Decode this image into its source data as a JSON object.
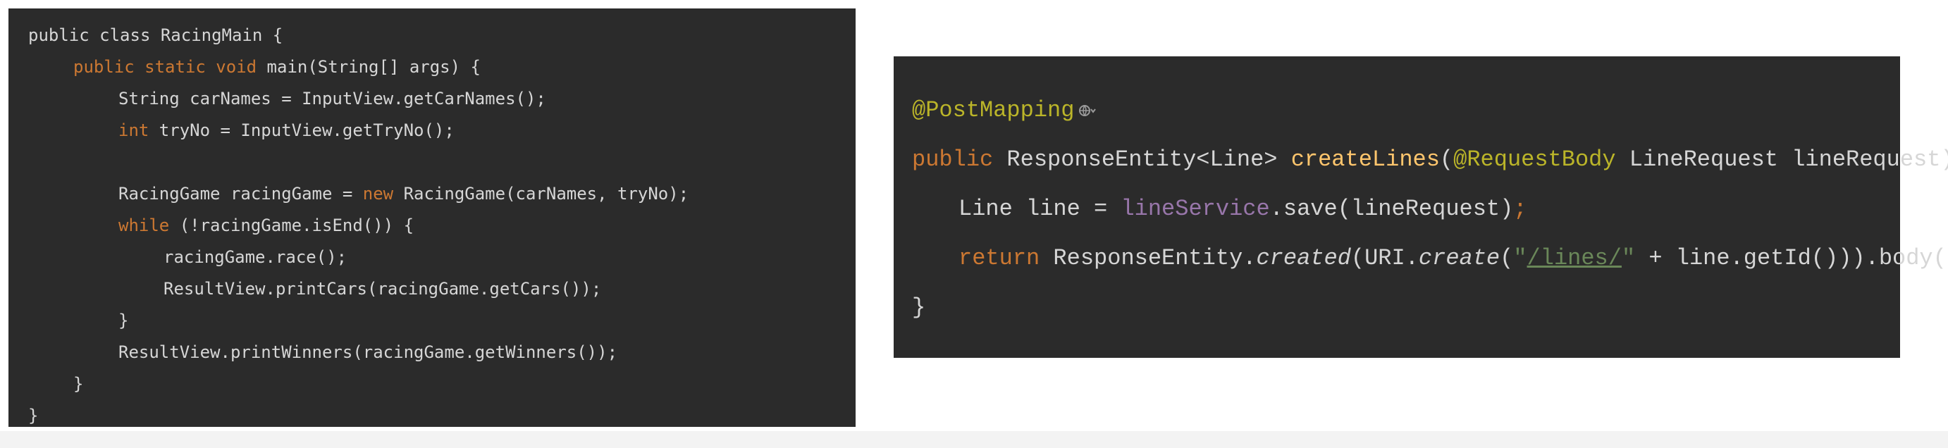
{
  "left_code": {
    "lines": [
      {
        "parts": [
          {
            "t": "public class RacingMain {",
            "c": "txt"
          }
        ]
      },
      {
        "parts": [
          {
            "t": "public static void ",
            "c": "kw"
          },
          {
            "t": "main(String[] args) {",
            "c": "txt"
          }
        ],
        "indent": 1
      },
      {
        "parts": [
          {
            "t": "String carNames = InputView.getCarNames();",
            "c": "txt"
          }
        ],
        "indent": 2
      },
      {
        "parts": [
          {
            "t": "int ",
            "c": "kw"
          },
          {
            "t": "tryNo = InputView.getTryNo();",
            "c": "txt"
          }
        ],
        "indent": 2
      },
      {
        "parts": [],
        "indent": 0
      },
      {
        "parts": [
          {
            "t": "RacingGame racingGame = ",
            "c": "txt"
          },
          {
            "t": "new ",
            "c": "kw"
          },
          {
            "t": "RacingGame(carNames, tryNo);",
            "c": "txt"
          }
        ],
        "indent": 2
      },
      {
        "parts": [
          {
            "t": "while ",
            "c": "kw"
          },
          {
            "t": "(!racingGame.isEnd()) {",
            "c": "txt"
          }
        ],
        "indent": 2
      },
      {
        "parts": [
          {
            "t": "racingGame.race();",
            "c": "txt"
          }
        ],
        "indent": 3
      },
      {
        "parts": [
          {
            "t": "ResultView.printCars(racingGame.getCars());",
            "c": "txt"
          }
        ],
        "indent": 3
      },
      {
        "parts": [
          {
            "t": "}",
            "c": "txt"
          }
        ],
        "indent": 2
      },
      {
        "parts": [
          {
            "t": "ResultView.printWinners(racingGame.getWinners());",
            "c": "txt"
          }
        ],
        "indent": 2
      },
      {
        "parts": [
          {
            "t": "}",
            "c": "txt"
          }
        ],
        "indent": 1
      },
      {
        "parts": [
          {
            "t": "}",
            "c": "txt"
          }
        ],
        "indent": 0
      }
    ]
  },
  "right_code": {
    "lines": [
      {
        "parts": [
          {
            "t": "@PostMapping",
            "c": "ann"
          }
        ],
        "marker": "globe-chevron-icon"
      },
      {
        "parts": [
          {
            "t": "public ",
            "c": "kw"
          },
          {
            "t": "ResponseEntity<Line> ",
            "c": "txt"
          },
          {
            "t": "createLines",
            "c": "fn"
          },
          {
            "t": "(",
            "c": "txt"
          },
          {
            "t": "@RequestBody ",
            "c": "ann"
          },
          {
            "t": "LineRequest lineRequest) {",
            "c": "txt"
          }
        ]
      },
      {
        "parts": [
          {
            "t": "Line line = ",
            "c": "txt"
          },
          {
            "t": "lineService",
            "c": "fld"
          },
          {
            "t": ".save(lineRequest)",
            "c": "txt"
          },
          {
            "t": ";",
            "c": "kw"
          }
        ],
        "indent": 1
      },
      {
        "parts": [
          {
            "t": "return ",
            "c": "kw"
          },
          {
            "t": "ResponseEntity.",
            "c": "txt"
          },
          {
            "t": "created",
            "c": "it"
          },
          {
            "t": "(URI.",
            "c": "txt"
          },
          {
            "t": "create",
            "c": "it"
          },
          {
            "t": "(",
            "c": "txt"
          },
          {
            "t": "\"",
            "c": "str"
          },
          {
            "t": "/lines/",
            "c": "str und"
          },
          {
            "t": "\"",
            "c": "str"
          },
          {
            "t": " + line.getId())).body(line)",
            "c": "txt"
          },
          {
            "t": ";",
            "c": "kw"
          }
        ],
        "indent": 1
      },
      {
        "parts": [
          {
            "t": "}",
            "c": "txt"
          }
        ]
      }
    ]
  },
  "colors": {
    "panel_bg": "#2b2b2b",
    "keyword": "#cc7832",
    "annotation": "#bbb529",
    "field": "#9876aa",
    "method": "#ffc66d",
    "string": "#6a8759",
    "text": "#d6d6d6"
  }
}
